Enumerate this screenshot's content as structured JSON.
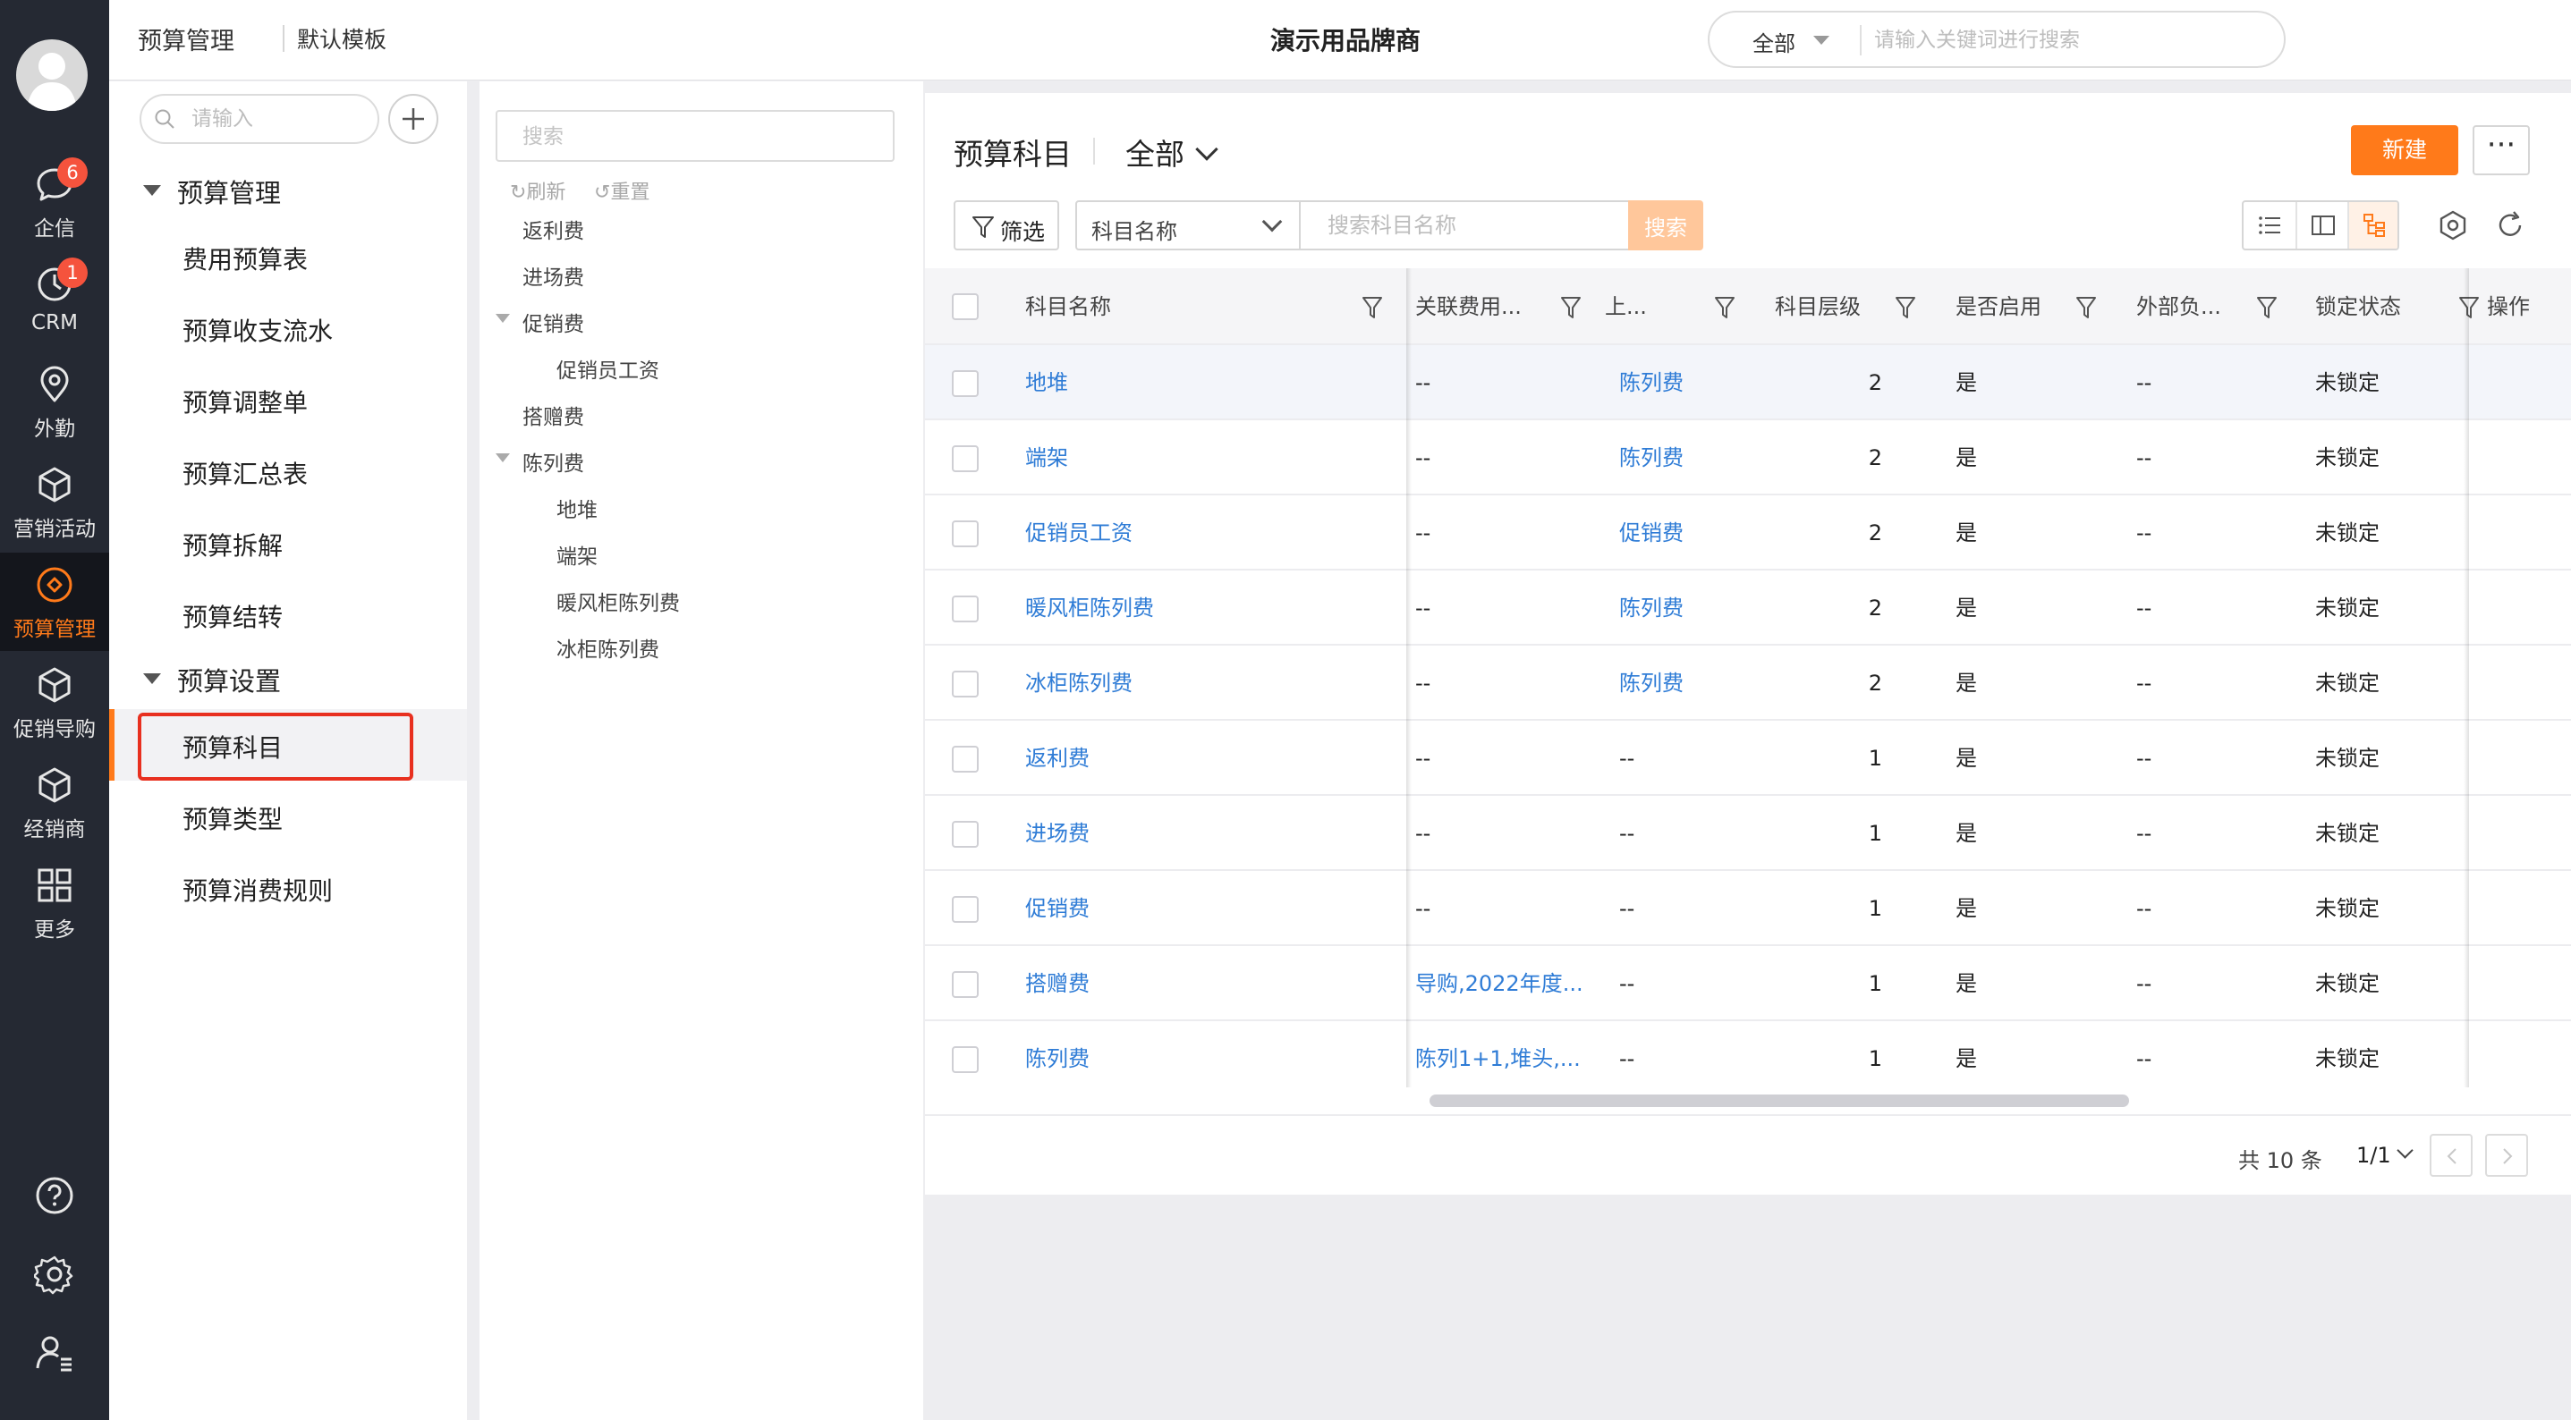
{
  "rail": {
    "items": [
      {
        "label": "企信",
        "icon": "chat-bubble-icon",
        "badge": "6"
      },
      {
        "label": "CRM",
        "icon": "clock-icon",
        "badge": "1"
      },
      {
        "label": "外勤",
        "icon": "location-pin-icon",
        "badge": ""
      },
      {
        "label": "营销活动",
        "icon": "cube-icon",
        "badge": ""
      },
      {
        "label": "预算管理",
        "icon": "budget-diamond-icon",
        "badge": ""
      },
      {
        "label": "促销导购",
        "icon": "cube-icon",
        "badge": ""
      },
      {
        "label": "经销商",
        "icon": "cube-icon",
        "badge": ""
      },
      {
        "label": "更多",
        "icon": "grid-icon",
        "badge": ""
      }
    ],
    "active_index": 4,
    "accent": "#ff7a1a",
    "background": "#252933"
  },
  "header": {
    "module": "预算管理",
    "template": "默认模板",
    "company": "演示用品牌商",
    "search_scope": "全部",
    "search_placeholder": "请输入关键词进行搜索"
  },
  "subnav": {
    "search_placeholder": "请输入",
    "groups": [
      {
        "label": "预算管理",
        "items": [
          "费用预算表",
          "预算收支流水",
          "预算调整单",
          "预算汇总表",
          "预算拆解",
          "预算结转"
        ]
      },
      {
        "label": "预算设置",
        "items": [
          "预算科目",
          "预算类型",
          "预算消费规则"
        ]
      }
    ],
    "active_item": "预算科目"
  },
  "tree": {
    "search_placeholder": "搜索",
    "refresh_label": "刷新",
    "reset_label": "重置",
    "nodes": [
      {
        "label": "返利费",
        "level": 0,
        "expanded": null
      },
      {
        "label": "进场费",
        "level": 0,
        "expanded": null
      },
      {
        "label": "促销费",
        "level": 0,
        "expanded": true
      },
      {
        "label": "促销员工资",
        "level": 1,
        "expanded": null
      },
      {
        "label": "搭赠费",
        "level": 0,
        "expanded": null
      },
      {
        "label": "陈列费",
        "level": 0,
        "expanded": true
      },
      {
        "label": "地堆",
        "level": 1,
        "expanded": null
      },
      {
        "label": "端架",
        "level": 1,
        "expanded": null
      },
      {
        "label": "暖风柜陈列费",
        "level": 1,
        "expanded": null
      },
      {
        "label": "冰柜陈列费",
        "level": 1,
        "expanded": null
      }
    ]
  },
  "main": {
    "title": "预算科目",
    "scope": "全部",
    "new_label": "新建",
    "more_label": "···",
    "filter_label": "筛选",
    "field_select": "科目名称",
    "keyword_placeholder": "搜索科目名称",
    "search_label": "搜索",
    "columns": [
      "科目名称",
      "关联费用...",
      "上...",
      "科目层级",
      "是否启用",
      "外部负...",
      "锁定状态",
      "操作"
    ],
    "rows": [
      {
        "name": "地堆",
        "related": "--",
        "parent": "陈列费",
        "level": "2",
        "enabled": "是",
        "external": "--",
        "lock": "未锁定"
      },
      {
        "name": "端架",
        "related": "--",
        "parent": "陈列费",
        "level": "2",
        "enabled": "是",
        "external": "--",
        "lock": "未锁定"
      },
      {
        "name": "促销员工资",
        "related": "--",
        "parent": "促销费",
        "level": "2",
        "enabled": "是",
        "external": "--",
        "lock": "未锁定"
      },
      {
        "name": "暖风柜陈列费",
        "related": "--",
        "parent": "陈列费",
        "level": "2",
        "enabled": "是",
        "external": "--",
        "lock": "未锁定"
      },
      {
        "name": "冰柜陈列费",
        "related": "--",
        "parent": "陈列费",
        "level": "2",
        "enabled": "是",
        "external": "--",
        "lock": "未锁定"
      },
      {
        "name": "返利费",
        "related": "--",
        "parent": "--",
        "level": "1",
        "enabled": "是",
        "external": "--",
        "lock": "未锁定"
      },
      {
        "name": "进场费",
        "related": "--",
        "parent": "--",
        "level": "1",
        "enabled": "是",
        "external": "--",
        "lock": "未锁定"
      },
      {
        "name": "促销费",
        "related": "--",
        "parent": "--",
        "level": "1",
        "enabled": "是",
        "external": "--",
        "lock": "未锁定"
      },
      {
        "name": "搭赠费",
        "related": "导购,2022年度...",
        "parent": "--",
        "level": "1",
        "enabled": "是",
        "external": "--",
        "lock": "未锁定"
      },
      {
        "name": "陈列费",
        "related": "陈列1+1,堆头,...",
        "parent": "--",
        "level": "1",
        "enabled": "是",
        "external": "--",
        "lock": "未锁定"
      }
    ],
    "total": "共 10 条",
    "page": "1/1",
    "link_color": "#2f7cd6"
  }
}
